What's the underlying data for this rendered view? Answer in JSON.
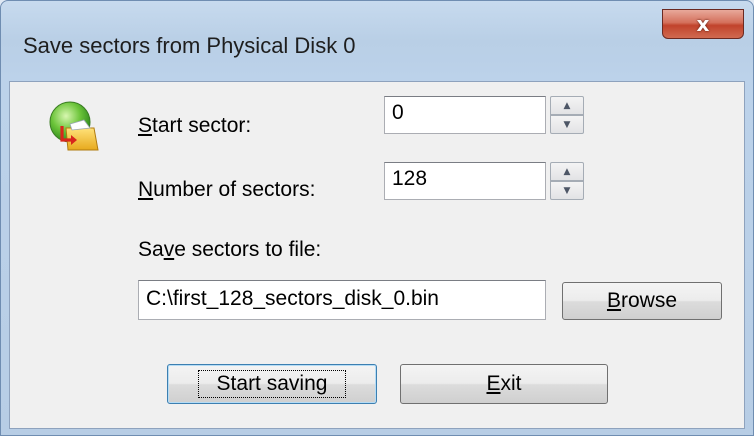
{
  "window": {
    "title": "Save sectors from Physical Disk 0",
    "close_glyph": "x"
  },
  "icons": {
    "app": "save-sectors-icon",
    "close": "close-icon",
    "spin_up": "spin-up-arrow-icon",
    "spin_down": "spin-down-arrow-icon"
  },
  "form": {
    "start_sector": {
      "label_accel": "S",
      "label_rest": "tart sector:",
      "value": "0"
    },
    "number_of_sectors": {
      "label_accel": "N",
      "label_rest": "umber of sectors:",
      "value": "128"
    },
    "save_to_file": {
      "label_pre": "Sa",
      "label_accel": "v",
      "label_rest": "e sectors to file:",
      "value": "C:\\first_128_sectors_disk_0.bin"
    }
  },
  "buttons": {
    "browse": {
      "accel": "B",
      "rest": "rowse"
    },
    "start_saving": {
      "label": "Start saving"
    },
    "exit": {
      "accel": "E",
      "rest": "xit"
    }
  },
  "colors": {
    "close_button": "#c1432c",
    "title_bar": "#c7daee",
    "client_bg": "#f0f0f0"
  }
}
